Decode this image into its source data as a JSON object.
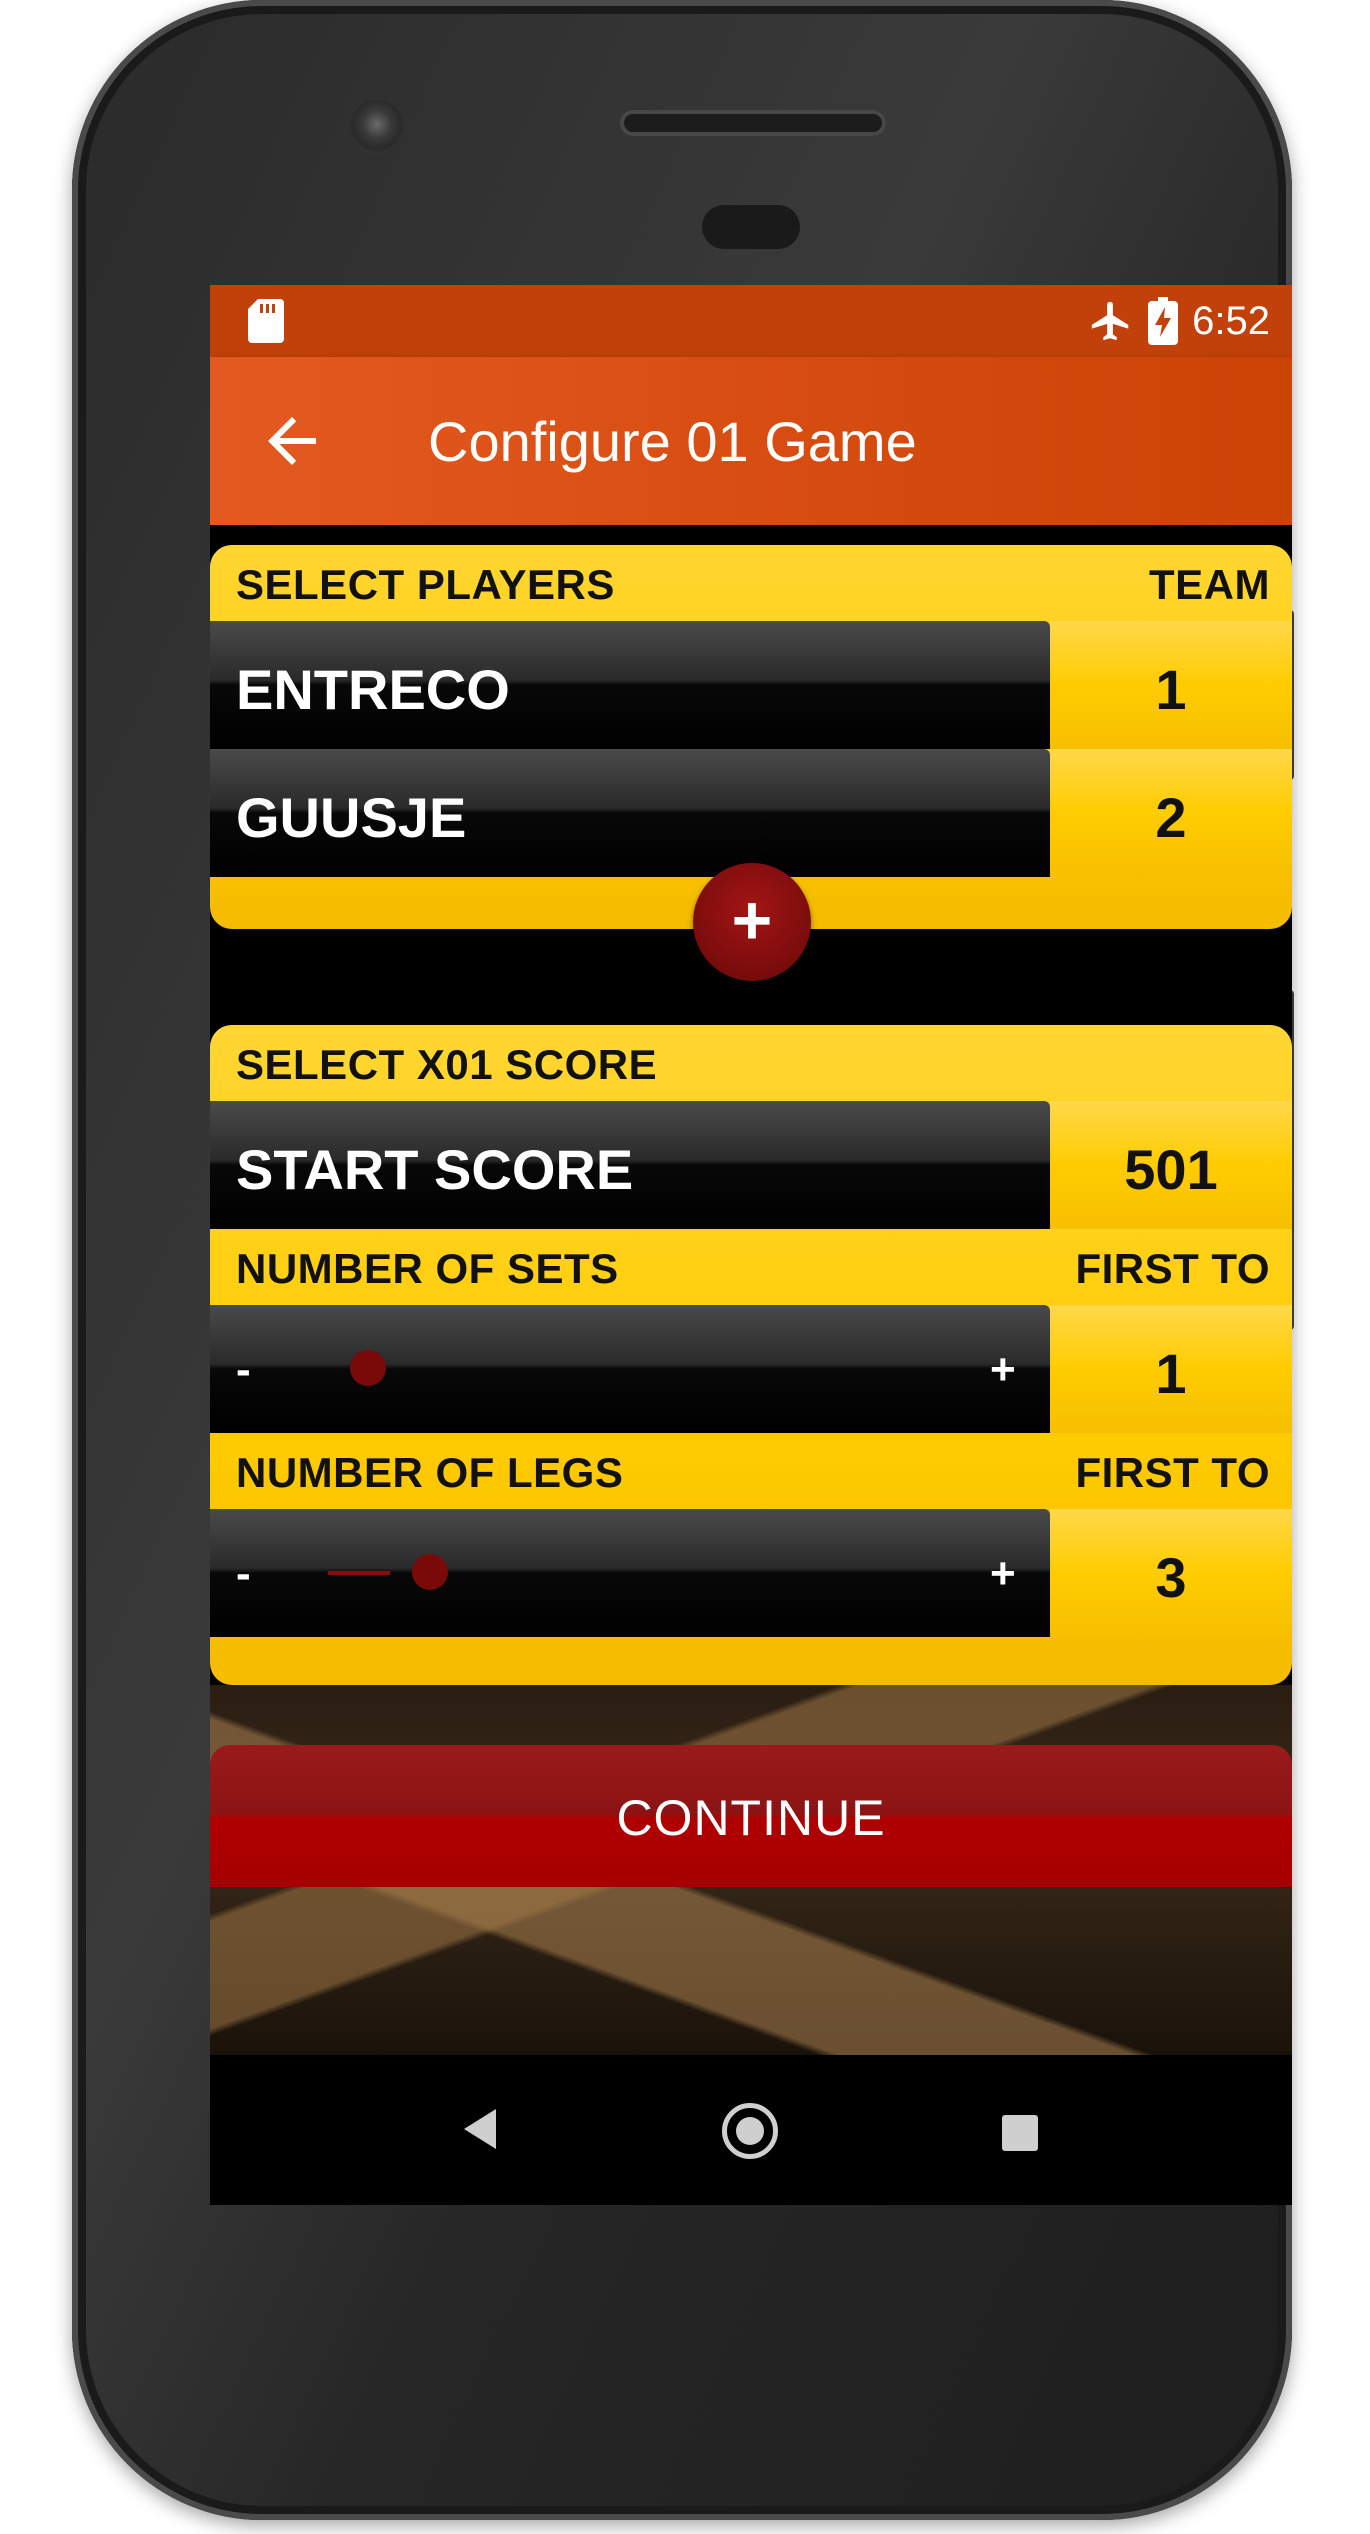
{
  "status_bar": {
    "time": "6:52",
    "icons": [
      "sd-card-icon",
      "airplane-icon",
      "battery-charging-icon"
    ]
  },
  "app_bar": {
    "title": "Configure 01 Game",
    "back_icon": "arrow-left-icon"
  },
  "players_card": {
    "header_left": "SELECT PLAYERS",
    "header_right": "TEAM",
    "players": [
      {
        "name": "ENTRECO",
        "team": "1"
      },
      {
        "name": "GUUSJE",
        "team": "2"
      }
    ],
    "add_button": "+"
  },
  "score_card": {
    "header": "SELECT X01 SCORE",
    "start_score_label": "START SCORE",
    "start_score_value": "501",
    "sets": {
      "label": "NUMBER OF SETS",
      "right_label": "FIRST TO",
      "minus": "-",
      "plus": "+",
      "value": "1",
      "slider_level": 0.0
    },
    "legs": {
      "label": "NUMBER OF LEGS",
      "right_label": "FIRST TO",
      "minus": "-",
      "plus": "+",
      "value": "3",
      "slider_level": 0.1
    }
  },
  "continue_button": "CONTINUE",
  "colors": {
    "status_bar": "#c2410b",
    "app_bar": "#d84d12",
    "card_yellow": "#ffcc00",
    "accent_red": "#8c1414"
  },
  "nav_bar": {
    "icons": [
      "nav-back-icon",
      "nav-home-icon",
      "nav-recents-icon"
    ]
  }
}
